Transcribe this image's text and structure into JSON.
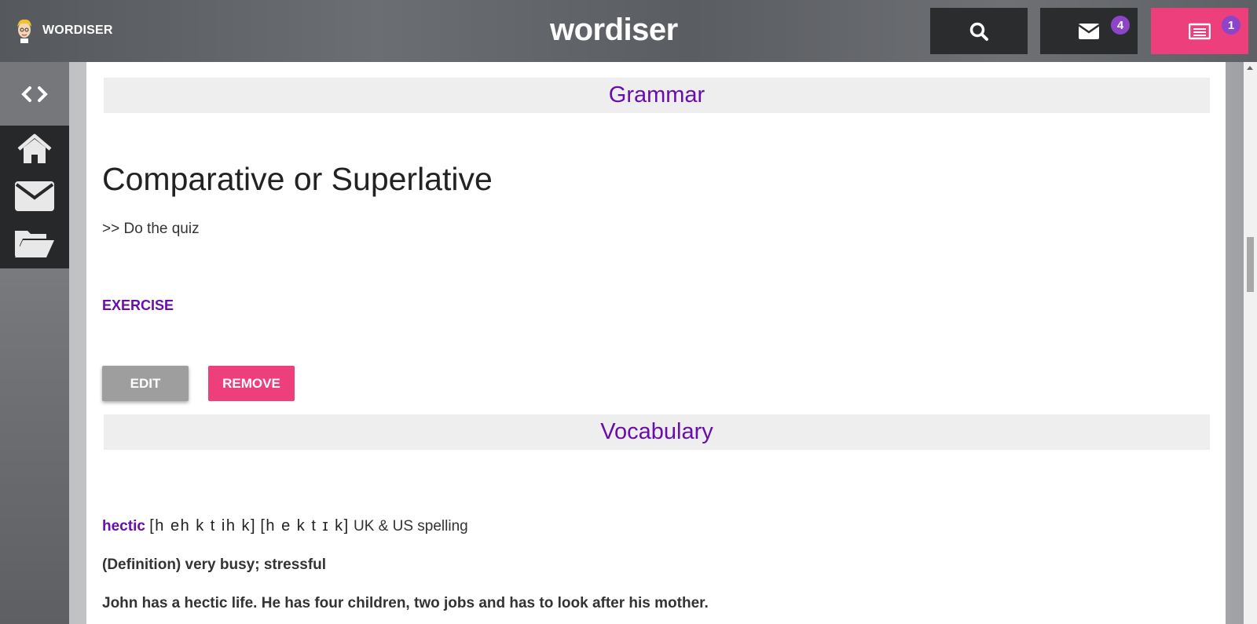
{
  "header": {
    "user_name": "WORDISER",
    "logo_text": "wordiser",
    "mail_badge": "4",
    "news_badge": "1",
    "accent_color": "#ec3f7b"
  },
  "sidebar": {
    "items": [
      {
        "icon": "arrows-icon"
      },
      {
        "icon": "home-icon"
      },
      {
        "icon": "envelope-icon"
      },
      {
        "icon": "folder-icon"
      }
    ]
  },
  "main": {
    "grammar_heading": "Grammar",
    "lesson_title": "Comparative or Superlative",
    "quiz_link": ">> Do the quiz",
    "exercise_label": "EXERCISE",
    "edit_label": "EDIT",
    "remove_label": "REMOVE",
    "vocabulary_heading": "Vocabulary",
    "vocab": {
      "word": "hectic",
      "phonetic_1": "[h eh k t ih k]",
      "phonetic_2": "[h e k t ɪ k]",
      "spelling_note": "UK & US spelling",
      "definition": "(Definition) very busy; stressful",
      "example": "John has a hectic life. He has four children, two jobs and has to look after his mother."
    }
  }
}
